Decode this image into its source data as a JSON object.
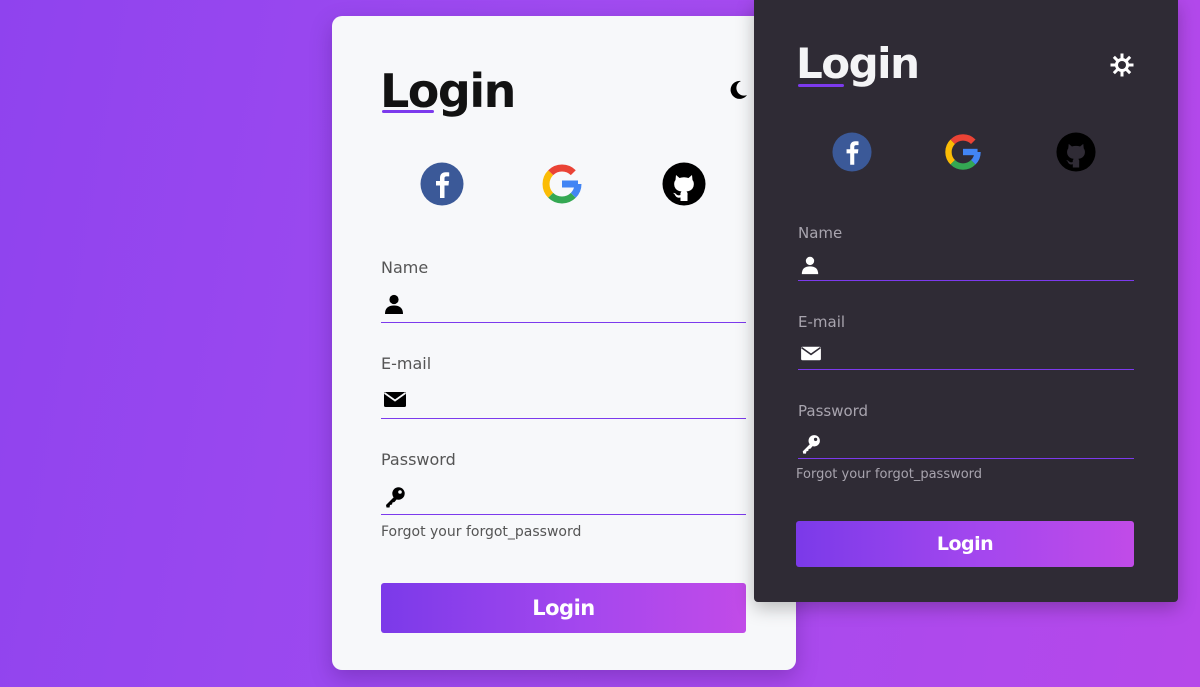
{
  "colors": {
    "accent": "#7c3aed",
    "button_gradient_start": "#7b3ae9",
    "button_gradient_end": "#c14be8",
    "light_card_bg": "#f7f8fa",
    "dark_card_bg": "#2f2b35",
    "facebook_blue": "#3b5998"
  },
  "light_card": {
    "title": "Login",
    "mode_toggle_icon": "moon-icon",
    "social_icons": [
      "facebook-icon",
      "google-icon",
      "github-icon"
    ],
    "fields": {
      "name": {
        "label": "Name",
        "value": "",
        "icon": "user-icon"
      },
      "email": {
        "label": "E-mail",
        "value": "",
        "icon": "envelope-icon"
      },
      "password": {
        "label": "Password",
        "value": "",
        "icon": "key-icon"
      }
    },
    "forgot_text": "Forgot your forgot_password",
    "login_label": "Login"
  },
  "dark_card": {
    "title": "Login",
    "mode_toggle_icon": "sun-icon",
    "social_icons": [
      "facebook-icon",
      "google-icon",
      "github-icon"
    ],
    "fields": {
      "name": {
        "label": "Name",
        "value": "",
        "icon": "user-icon"
      },
      "email": {
        "label": "E-mail",
        "value": "",
        "icon": "envelope-icon"
      },
      "password": {
        "label": "Password",
        "value": "",
        "icon": "key-icon"
      }
    },
    "forgot_text": "Forgot your forgot_password",
    "login_label": "Login"
  }
}
